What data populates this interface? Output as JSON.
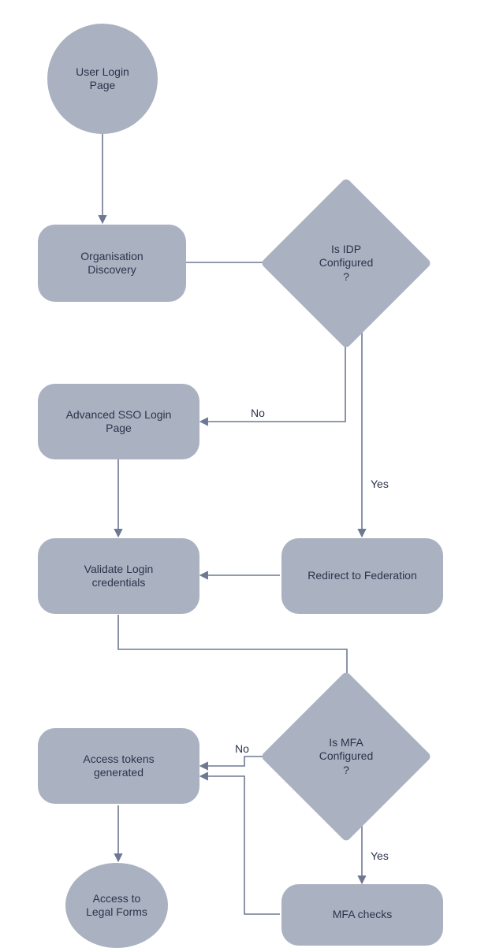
{
  "nodes": {
    "start": {
      "label": "User Login\nPage"
    },
    "org": {
      "label": "Organisation\nDiscovery"
    },
    "idp": {
      "label": "Is IDP\nConfigured\n?"
    },
    "sso": {
      "label": "Advanced SSO Login\nPage"
    },
    "fed": {
      "label": "Redirect to Federation"
    },
    "validate": {
      "label": "Validate Login\ncredentials"
    },
    "mfa": {
      "label": "Is MFA\nConfigured\n?"
    },
    "tokens": {
      "label": "Access tokens\ngenerated"
    },
    "mfachecks": {
      "label": "MFA checks"
    },
    "end": {
      "label": "Access to\nLegal Forms"
    }
  },
  "edge_labels": {
    "idp_no": "No",
    "idp_yes": "Yes",
    "mfa_no": "No",
    "mfa_yes": "Yes"
  },
  "style": {
    "node_fill": "#aab1c1",
    "text_color": "#2b344b",
    "arrow_color": "#6f7892"
  }
}
